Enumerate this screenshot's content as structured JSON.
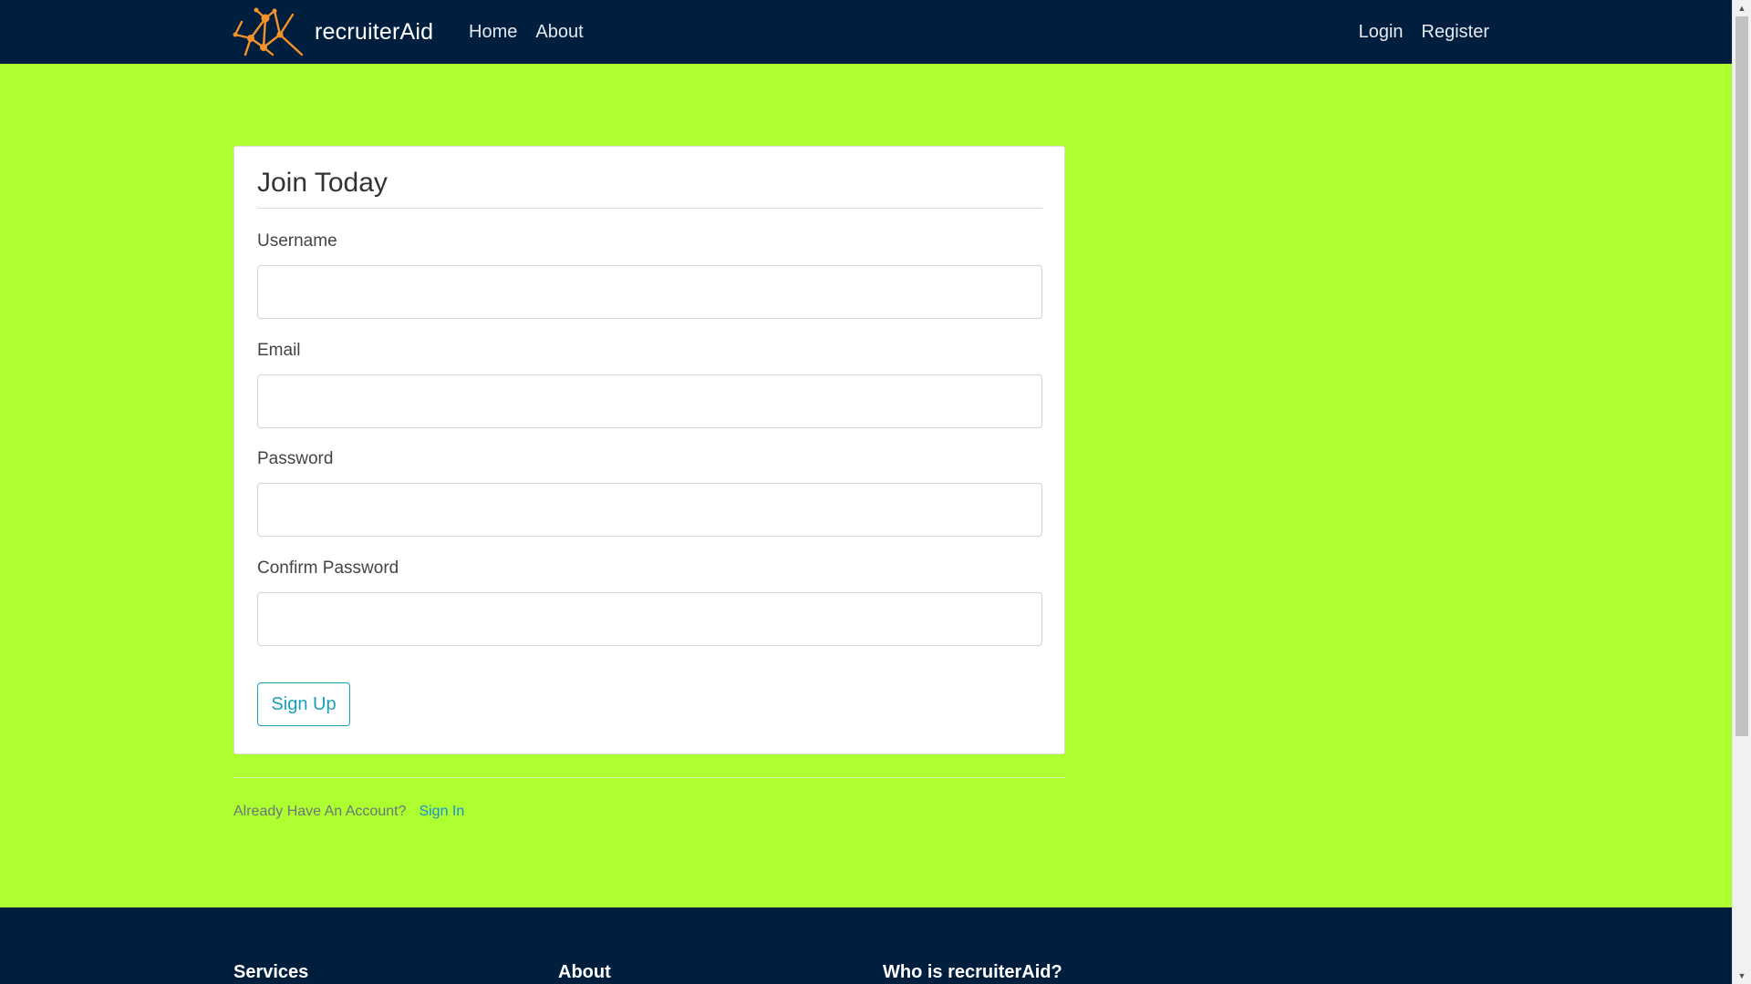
{
  "navbar": {
    "brand": "recruiterAid",
    "logo_icon": "network-graph-icon",
    "links_left": [
      "Home",
      "About"
    ],
    "links_right": [
      "Login",
      "Register"
    ],
    "background": "#001f3f"
  },
  "form": {
    "legend": "Join Today",
    "fields": [
      {
        "label": "Username",
        "value": "",
        "placeholder": ""
      },
      {
        "label": "Email",
        "value": "",
        "placeholder": ""
      },
      {
        "label": "Password",
        "value": "",
        "placeholder": ""
      },
      {
        "label": "Confirm Password",
        "value": "",
        "placeholder": ""
      }
    ],
    "submit_label": "Sign Up",
    "accent": "#17a2b8"
  },
  "account": {
    "prompt": "Already Have An Account?",
    "link": "Sign In"
  },
  "footer": {
    "headings": [
      "Services",
      "About",
      "Who is recruiterAid?"
    ]
  },
  "colors": {
    "page_background": "#adff2f",
    "nav_background": "#001f3f",
    "logo_orange": "#f5922a"
  }
}
